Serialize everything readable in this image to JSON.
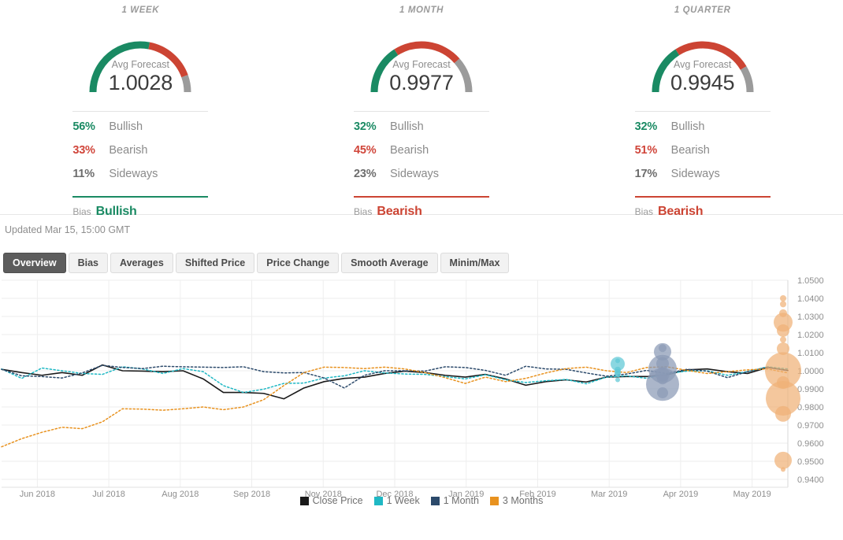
{
  "forecast_panels": [
    {
      "title": "1 WEEK",
      "gauge_label": "Avg Forecast",
      "gauge_value": "1.0028",
      "stats": [
        {
          "pct": "56%",
          "name": "Bullish",
          "kind": "bull"
        },
        {
          "pct": "33%",
          "name": "Bearish",
          "kind": "bear"
        },
        {
          "pct": "11%",
          "name": "Sideways",
          "kind": "side"
        }
      ],
      "bias_label": "Bias",
      "bias_value": "Bullish",
      "bias_color": "#1a8a63",
      "arc": {
        "green": 56,
        "red": 33,
        "gray": 11
      }
    },
    {
      "title": "1 MONTH",
      "gauge_label": "Avg Forecast",
      "gauge_value": "0.9977",
      "stats": [
        {
          "pct": "32%",
          "name": "Bullish",
          "kind": "bull"
        },
        {
          "pct": "45%",
          "name": "Bearish",
          "kind": "bear"
        },
        {
          "pct": "23%",
          "name": "Sideways",
          "kind": "side"
        }
      ],
      "bias_label": "Bias",
      "bias_value": "Bearish",
      "bias_color": "#cc4433",
      "arc": {
        "green": 32,
        "red": 45,
        "gray": 23
      }
    },
    {
      "title": "1 QUARTER",
      "gauge_label": "Avg Forecast",
      "gauge_value": "0.9945",
      "stats": [
        {
          "pct": "32%",
          "name": "Bullish",
          "kind": "bull"
        },
        {
          "pct": "51%",
          "name": "Bearish",
          "kind": "bear"
        },
        {
          "pct": "17%",
          "name": "Sideways",
          "kind": "side"
        }
      ],
      "bias_label": "Bias",
      "bias_value": "Bearish",
      "bias_color": "#cc4433",
      "arc": {
        "green": 32,
        "red": 51,
        "gray": 17
      }
    }
  ],
  "updated_text": "Updated Mar 15, 15:00 GMT",
  "tabs": [
    {
      "label": "Overview",
      "active": true
    },
    {
      "label": "Bias",
      "active": false
    },
    {
      "label": "Averages",
      "active": false
    },
    {
      "label": "Shifted Price",
      "active": false
    },
    {
      "label": "Price Change",
      "active": false
    },
    {
      "label": "Smooth Average",
      "active": false
    },
    {
      "label": "Minim/Max",
      "active": false
    }
  ],
  "colors": {
    "green": "#1a8a63",
    "red": "#cc4433",
    "gray": "#9b9b9b",
    "close_price": "#1a1a1a",
    "one_week": "#1fb8c4",
    "one_month": "#2c4a6b",
    "three_months": "#e8921f",
    "bubble_week": "#5ec8d6",
    "bubble_month": "#8a9ab5",
    "bubble_quarter": "#f0b277",
    "gridline": "#eeeeee",
    "axis_text": "#8e8e8e"
  },
  "chart_data": {
    "type": "line",
    "title": "",
    "xlabel": "",
    "ylabel": "",
    "ylim": [
      0.94,
      1.05
    ],
    "ytick_step": 0.01,
    "ytick_labels": [
      "1.0500",
      "1.0400",
      "1.0300",
      "1.0200",
      "1.0100",
      "1.0000",
      "0.9900",
      "0.9800",
      "0.9700",
      "0.9600",
      "0.9500",
      "0.9400"
    ],
    "xtick_labels": [
      "Jun 2018",
      "Jul 2018",
      "Aug 2018",
      "Sep 2018",
      "Nov 2018",
      "Dec 2018",
      "Jan 2019",
      "Feb 2019",
      "Mar 2019",
      "Apr 2019",
      "May 2019"
    ],
    "grid": true,
    "legend_position": "bottom",
    "legend": [
      {
        "label": "Close Price",
        "color": "#1a1a1a",
        "style": "solid"
      },
      {
        "label": "1 Week",
        "color": "#1fb8c4",
        "style": "dotted"
      },
      {
        "label": "1 Month",
        "color": "#2c4a6b",
        "style": "dotted"
      },
      {
        "label": "3 Months",
        "color": "#e8921f",
        "style": "dotted"
      }
    ],
    "series": [
      {
        "name": "Close Price",
        "color": "#1a1a1a",
        "style": "solid",
        "values": [
          1.0008,
          0.999,
          0.9975,
          0.999,
          0.9975,
          1.0032,
          1.0,
          0.9998,
          0.9995,
          1.0,
          0.9955,
          0.988,
          0.988,
          0.9875,
          0.9845,
          0.9905,
          0.994,
          0.9958,
          0.9965,
          0.9985,
          0.9998,
          0.999,
          0.9975,
          0.9965,
          0.998,
          0.9955,
          0.992,
          0.994,
          0.995,
          0.9938,
          0.9965,
          0.9968,
          0.9968,
          0.9978,
          1.0005,
          1.001,
          0.9995,
          0.9985,
          1.0018,
          1.0002
        ]
      },
      {
        "name": "1 Week",
        "color": "#1fb8c4",
        "style": "dotted",
        "values": [
          1.001,
          0.9958,
          1.0015,
          1.0,
          0.9985,
          0.998,
          1.0022,
          1.001,
          0.9985,
          1.0012,
          0.9995,
          0.9918,
          0.988,
          0.9898,
          0.993,
          0.9932,
          0.996,
          0.9972,
          1.0,
          0.9988,
          0.9982,
          0.998,
          0.9968,
          0.9955,
          0.9978,
          0.995,
          0.9935,
          0.9945,
          0.9952,
          0.9928,
          0.9965,
          0.9972,
          0.9958,
          0.9985,
          0.9998,
          1.0,
          0.9975,
          0.9995,
          1.0022,
          1.001
        ]
      },
      {
        "name": "1 Month",
        "color": "#2c4a6b",
        "style": "dotted",
        "values": [
          1.0008,
          0.9972,
          0.9968,
          0.996,
          0.9988,
          1.003,
          1.0018,
          1.0012,
          1.0025,
          1.0022,
          1.002,
          1.0018,
          1.0022,
          0.9995,
          0.9988,
          0.999,
          0.996,
          0.9905,
          0.9975,
          1.0,
          1.0,
          0.9998,
          1.0022,
          1.0018,
          1.0002,
          0.9975,
          1.0025,
          1.001,
          1.0008,
          0.9988,
          0.997,
          0.9982,
          1.0002,
          0.9985,
          1.0008,
          0.9998,
          0.9962,
          0.9995,
          1.002,
          1.0
        ]
      },
      {
        "name": "3 Months",
        "color": "#e8921f",
        "style": "dotted",
        "values": [
          0.958,
          0.9625,
          0.966,
          0.9688,
          0.968,
          0.9718,
          0.979,
          0.9788,
          0.9782,
          0.979,
          0.98,
          0.9785,
          0.98,
          0.984,
          0.9918,
          0.999,
          1.002,
          1.0018,
          1.0012,
          1.002,
          1.001,
          0.999,
          0.9962,
          0.993,
          0.9965,
          0.994,
          0.9958,
          0.9988,
          1.0012,
          1.002,
          1.0,
          0.999,
          1.0018,
          1.0022,
          1.0002,
          0.9985,
          0.9995,
          1.0005,
          1.001,
          0.9988
        ]
      }
    ],
    "bubble_clusters": [
      {
        "name": "1 Week",
        "color": "#5ec8d6",
        "x_label": "Mar 2019",
        "bubbles": [
          {
            "value": 1.0055,
            "weight": 3
          },
          {
            "value": 1.0038,
            "weight": 9
          },
          {
            "value": 1.0005,
            "weight": 4
          },
          {
            "value": 0.9992,
            "weight": 4
          },
          {
            "value": 0.9982,
            "weight": 4
          },
          {
            "value": 0.995,
            "weight": 3
          }
        ]
      },
      {
        "name": "1 Month",
        "color": "#8a9ab5",
        "x_label": "between Mar and Apr 2019",
        "bubbles": [
          {
            "value": 1.0125,
            "weight": 5
          },
          {
            "value": 1.0105,
            "weight": 11
          },
          {
            "value": 1.004,
            "weight": 8
          },
          {
            "value": 1.001,
            "weight": 18
          },
          {
            "value": 0.998,
            "weight": 9
          },
          {
            "value": 0.9955,
            "weight": 7
          },
          {
            "value": 0.9925,
            "weight": 21
          },
          {
            "value": 0.9878,
            "weight": 7
          }
        ]
      },
      {
        "name": "3 Months",
        "color": "#f0b277",
        "x_label": "May 2019",
        "bubbles": [
          {
            "value": 1.04,
            "weight": 4
          },
          {
            "value": 1.0368,
            "weight": 4
          },
          {
            "value": 1.0318,
            "weight": 5
          },
          {
            "value": 1.0268,
            "weight": 12
          },
          {
            "value": 1.0222,
            "weight": 8
          },
          {
            "value": 1.0172,
            "weight": 4
          },
          {
            "value": 1.0122,
            "weight": 8
          },
          {
            "value": 1.0002,
            "weight": 23
          },
          {
            "value": 0.9935,
            "weight": 8
          },
          {
            "value": 0.9848,
            "weight": 22
          },
          {
            "value": 0.9762,
            "weight": 10
          },
          {
            "value": 0.9505,
            "weight": 11
          },
          {
            "value": 0.9455,
            "weight": 3
          }
        ]
      }
    ]
  }
}
